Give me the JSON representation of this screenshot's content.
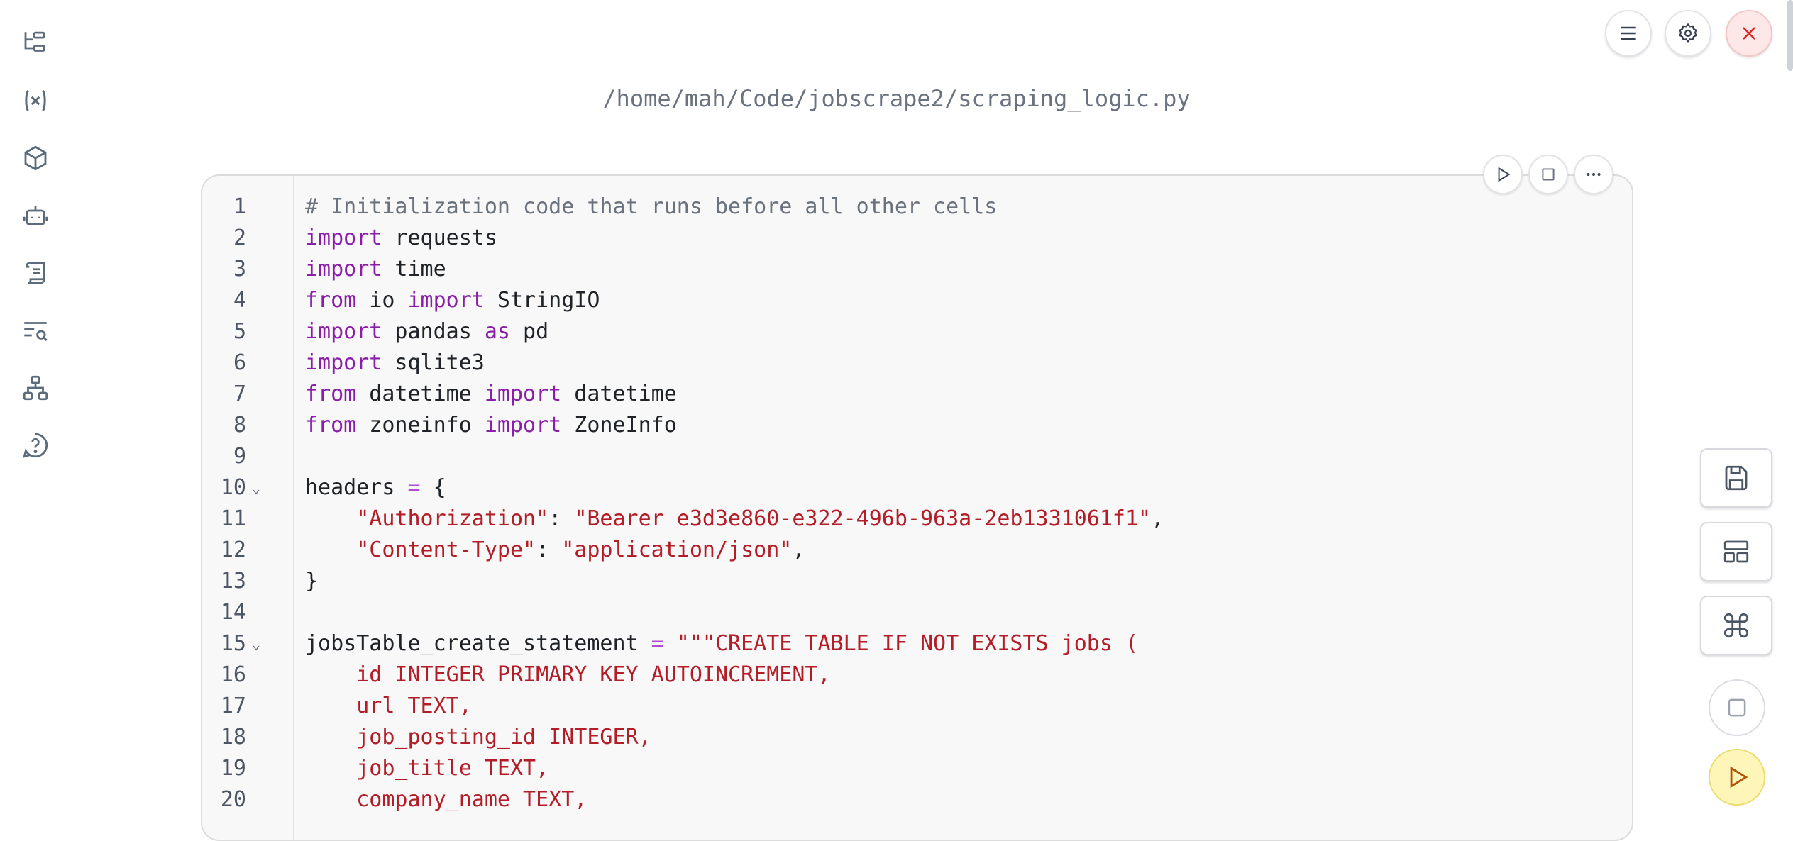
{
  "header": {
    "file_path": "/home/mah/Code/jobscrape2/scraping_logic.py"
  },
  "sidebar": {
    "icons": [
      "file-tree-icon",
      "variables-icon",
      "package-icon",
      "bot-icon",
      "scroll-icon",
      "search-list-icon",
      "sitemap-icon",
      "help-icon"
    ]
  },
  "top_buttons": [
    "menu-icon",
    "gear-icon",
    "close-icon"
  ],
  "cell_actions": [
    "run-icon",
    "stop-icon",
    "more-icon"
  ],
  "right_tools": [
    "save-icon",
    "layout-icon",
    "command-icon"
  ],
  "colors": {
    "keyword": "#8a1ea8",
    "string": "#b31d28",
    "comment": "#6a737d",
    "run_button": "#fdf6b8",
    "close_button": "#fde7e7"
  },
  "code_lines": [
    {
      "n": "1",
      "fold": "",
      "tokens": [
        [
          "c",
          "# Initialization code that runs before all other cells"
        ]
      ]
    },
    {
      "n": "2",
      "fold": "",
      "tokens": [
        [
          "k",
          "import"
        ],
        [
          "",
          " requests"
        ]
      ]
    },
    {
      "n": "3",
      "fold": "",
      "tokens": [
        [
          "k",
          "import"
        ],
        [
          "",
          " time"
        ]
      ]
    },
    {
      "n": "4",
      "fold": "",
      "tokens": [
        [
          "k",
          "from"
        ],
        [
          "",
          " io "
        ],
        [
          "k",
          "import"
        ],
        [
          "",
          " StringIO"
        ]
      ]
    },
    {
      "n": "5",
      "fold": "",
      "tokens": [
        [
          "k",
          "import"
        ],
        [
          "",
          " pandas "
        ],
        [
          "k",
          "as"
        ],
        [
          "",
          " pd"
        ]
      ]
    },
    {
      "n": "6",
      "fold": "",
      "tokens": [
        [
          "k",
          "import"
        ],
        [
          "",
          " sqlite3"
        ]
      ]
    },
    {
      "n": "7",
      "fold": "",
      "tokens": [
        [
          "k",
          "from"
        ],
        [
          "",
          " datetime "
        ],
        [
          "k",
          "import"
        ],
        [
          "",
          " datetime"
        ]
      ]
    },
    {
      "n": "8",
      "fold": "",
      "tokens": [
        [
          "k",
          "from"
        ],
        [
          "",
          " zoneinfo "
        ],
        [
          "k",
          "import"
        ],
        [
          "",
          " ZoneInfo"
        ]
      ]
    },
    {
      "n": "9",
      "fold": "",
      "tokens": []
    },
    {
      "n": "10",
      "fold": "⌄",
      "tokens": [
        [
          "",
          "headers "
        ],
        [
          "o",
          "="
        ],
        [
          "",
          " {"
        ]
      ]
    },
    {
      "n": "11",
      "fold": "",
      "tokens": [
        [
          "",
          "    "
        ],
        [
          "s",
          "\"Authorization\""
        ],
        [
          "",
          ": "
        ],
        [
          "s",
          "\"Bearer e3d3e860-e322-496b-963a-2eb1331061f1\""
        ],
        [
          "",
          ","
        ]
      ]
    },
    {
      "n": "12",
      "fold": "",
      "tokens": [
        [
          "",
          "    "
        ],
        [
          "s",
          "\"Content-Type\""
        ],
        [
          "",
          ": "
        ],
        [
          "s",
          "\"application/json\""
        ],
        [
          "",
          ","
        ]
      ]
    },
    {
      "n": "13",
      "fold": "",
      "tokens": [
        [
          "",
          "}"
        ]
      ]
    },
    {
      "n": "14",
      "fold": "",
      "tokens": []
    },
    {
      "n": "15",
      "fold": "⌄",
      "tokens": [
        [
          "",
          "jobsTable_create_statement "
        ],
        [
          "o",
          "="
        ],
        [
          "",
          " "
        ],
        [
          "s",
          "\"\"\"CREATE TABLE IF NOT EXISTS jobs ("
        ]
      ]
    },
    {
      "n": "16",
      "fold": "",
      "tokens": [
        [
          "s",
          "    id INTEGER PRIMARY KEY AUTOINCREMENT,"
        ]
      ]
    },
    {
      "n": "17",
      "fold": "",
      "tokens": [
        [
          "s",
          "    url TEXT,"
        ]
      ]
    },
    {
      "n": "18",
      "fold": "",
      "tokens": [
        [
          "s",
          "    job_posting_id INTEGER,"
        ]
      ]
    },
    {
      "n": "19",
      "fold": "",
      "tokens": [
        [
          "s",
          "    job_title TEXT,"
        ]
      ]
    },
    {
      "n": "20",
      "fold": "",
      "tokens": [
        [
          "s",
          "    company_name TEXT,"
        ]
      ]
    }
  ]
}
